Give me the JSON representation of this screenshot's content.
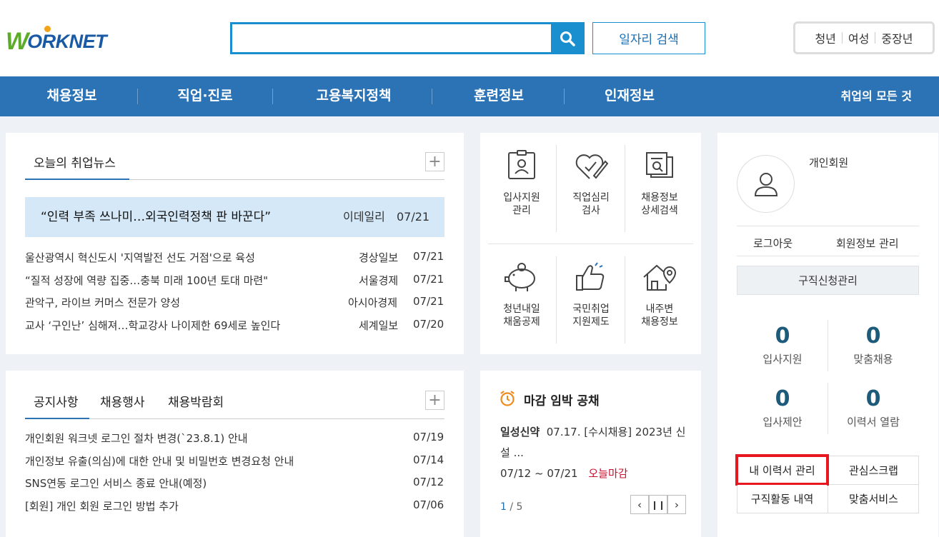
{
  "header": {
    "logo_w": "W",
    "logo_text": "ORKNET",
    "search": {
      "placeholder": "",
      "value": ""
    },
    "job_search_label": "일자리 검색",
    "targets": [
      "청년",
      "여성",
      "중장년"
    ]
  },
  "nav": {
    "items": [
      "채용정보",
      "직업·진로",
      "고용복지정책",
      "훈련정보",
      "인재정보"
    ],
    "right": "취업의 모든 것"
  },
  "news": {
    "tab": "오늘의 취업뉴스",
    "headline": {
      "title": "“인력 부족 쓰나미…외국인력정책 판 바꾼다”",
      "source": "이데일리",
      "date": "07/21"
    },
    "items": [
      {
        "title": "울산광역시 혁신도시 '지역발전 선도 거점'으로 육성",
        "source": "경상일보",
        "date": "07/21"
      },
      {
        "title": "“질적 성장에 역량 집중…충북 미래 100년 토대 마련\"",
        "source": "서울경제",
        "date": "07/21"
      },
      {
        "title": "관악구, 라이브 커머스 전문가 양성",
        "source": "아시아경제",
        "date": "07/21"
      },
      {
        "title": "교사 ‘구인난’ 심해져…학교강사 나이제한 69세로 높인다",
        "source": "세계일보",
        "date": "07/20"
      }
    ]
  },
  "services": [
    {
      "label1": "입사지원",
      "label2": "관리",
      "icon": "badge-icon"
    },
    {
      "label1": "직업심리",
      "label2": "검사",
      "icon": "heart-pencil-icon"
    },
    {
      "label1": "채용정보",
      "label2": "상세검색",
      "icon": "document-search-icon"
    },
    {
      "label1": "청년내일",
      "label2": "채움공제",
      "icon": "piggy-bank-icon"
    },
    {
      "label1": "국민취업",
      "label2": "지원제도",
      "icon": "thumbs-up-icon"
    },
    {
      "label1": "내주변",
      "label2": "채용정보",
      "icon": "house-location-icon"
    }
  ],
  "notices": {
    "tabs": [
      "공지사항",
      "채용행사",
      "채용박람회"
    ],
    "items": [
      {
        "title": "개인회원 워크넷 로그인 절차 변경(`23.8.1) 안내",
        "date": "07/19"
      },
      {
        "title": "개인정보 유출(의심)에 대한 안내 및 비밀번호 변경요청 안내",
        "date": "07/14"
      },
      {
        "title": "SNS연동 로그인 서비스 종료 안내(예정)",
        "date": "07/12"
      },
      {
        "title": "[회원] 개인 회원 로그인 방법 추가",
        "date": "07/06"
      }
    ]
  },
  "deadline": {
    "title": "마감 임박 공채",
    "company": "일성신약",
    "text": "07.17. [수시채용] 2023년 신설 ...",
    "period": "07/12 ~ 07/21",
    "badge": "오늘마감",
    "page_current": "1",
    "page_total": "/ 5"
  },
  "member": {
    "type": "개인회원",
    "logout": "로그아웃",
    "profile": "회원정보 관리",
    "apply_manage": "구직신청관리",
    "stats": [
      {
        "value": "0",
        "label": "입사지원"
      },
      {
        "value": "0",
        "label": "맞춤채용"
      },
      {
        "value": "0",
        "label": "입사제안"
      },
      {
        "value": "0",
        "label": "이력서 열람"
      }
    ],
    "buttons": [
      "내 이력서 관리",
      "관심스크랩",
      "구직활동 내역",
      "맞춤서비스"
    ],
    "highlight_color": "#e8161f"
  }
}
